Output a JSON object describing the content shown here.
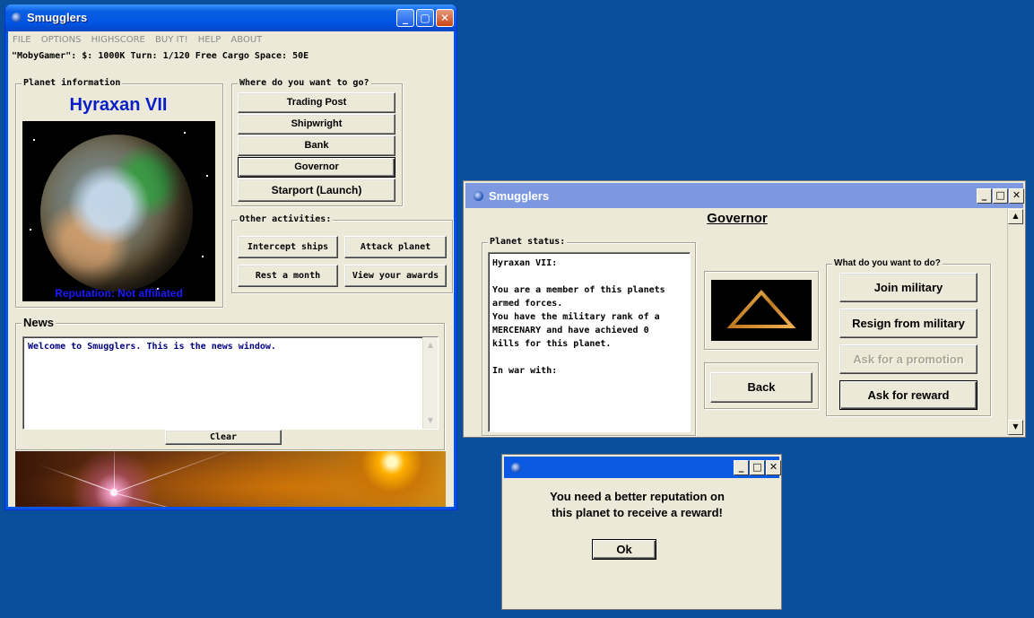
{
  "main_window": {
    "title": "Smugglers",
    "menu": [
      "FILE",
      "OPTIONS",
      "HIGHSCORE",
      "BUY IT!",
      "HELP",
      "ABOUT"
    ],
    "status_line": "\"MobyGamer\": $: 1000K Turn: 1/120 Free Cargo Space: 50E",
    "planet_info": {
      "label": "Planet information",
      "name": "Hyraxan VII",
      "reputation": "Reputation: Not affiliated"
    },
    "destinations": {
      "label": "Where do you want to go?",
      "buttons": [
        "Trading Post",
        "Shipwright",
        "Bank",
        "Governor",
        "Starport (Launch)"
      ]
    },
    "activities": {
      "label": "Other activities:",
      "buttons": [
        "Intercept ships",
        "Attack planet",
        "Rest a month",
        "View your awards"
      ]
    },
    "news": {
      "label": "News",
      "text": "Welcome to Smugglers. This is the news window.",
      "clear_label": "Clear"
    }
  },
  "governor_window": {
    "title": "Smugglers",
    "heading": "Governor",
    "status_label": "Planet status:",
    "status_lines": [
      "Hyraxan VII:",
      "",
      "You are a member of this planets",
      "armed forces.",
      "You have the military rank of a",
      "MERCENARY and have achieved 0",
      "kills for this planet.",
      "",
      "In war with:"
    ],
    "back_label": "Back",
    "actions_label": "What do you want to do?",
    "actions": [
      "Join military",
      "Resign from military",
      "Ask for a promotion",
      "Ask for reward"
    ]
  },
  "dialog": {
    "message_line1": "You need a better reputation on",
    "message_line2": "this planet to receive a reward!",
    "ok_label": "Ok"
  },
  "colors": {
    "desktop": "#0a4f9c",
    "planet_name": "#0a1ec8",
    "news_text": "#000080"
  }
}
